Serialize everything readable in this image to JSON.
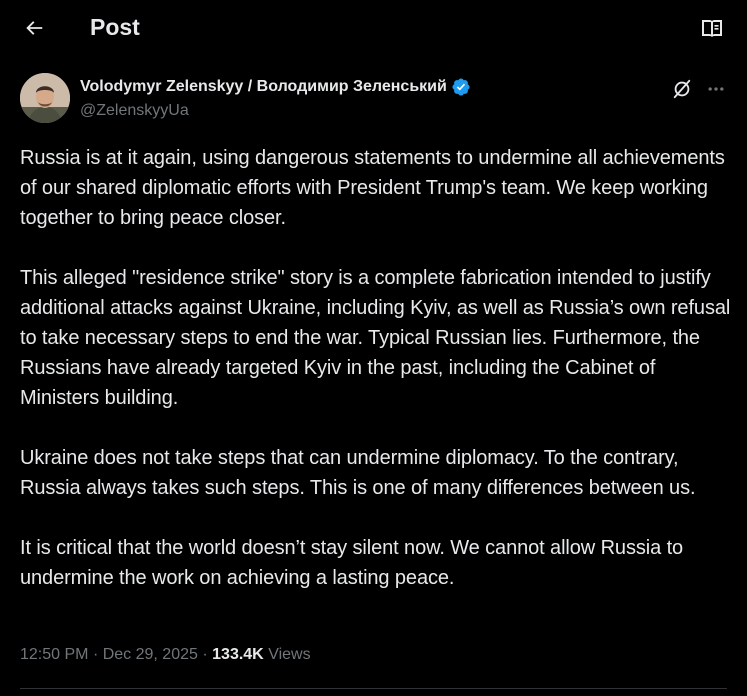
{
  "header": {
    "title": "Post",
    "back_icon": "arrow-left-icon",
    "reader_icon": "open-book-icon"
  },
  "author": {
    "name": "Volodymyr Zelenskyy / Володимир Зеленський",
    "handle": "@ZelenskyyUa",
    "verified_color": "#1d9bf0"
  },
  "post": {
    "paragraphs": [
      "Russia is at it again, using dangerous statements to undermine all achievements of our shared diplomatic efforts with President Trump's team. We keep working together to bring peace closer.",
      "This alleged \"residence strike\" story is a complete fabrication intended to justify additional attacks against Ukraine, including Kyiv, as well as Russia’s own refusal to take necessary steps to end the war. Typical Russian lies. Furthermore, the Russians have already targeted Kyiv in the past, including the Cabinet of Ministers building.",
      "Ukraine does not take steps that can undermine diplomacy. To the contrary, Russia always takes such steps. This is one of many differences between us.",
      "It is critical that the world doesn’t stay silent now. We cannot allow Russia to undermine the work on achieving a lasting peace."
    ],
    "time": "12:50 PM",
    "separator": "·",
    "date": "Dec 29, 2025",
    "views_count": "133.4K",
    "views_label": "Views"
  },
  "colors": {
    "background": "#000000",
    "text": "#e7e9ea",
    "secondary": "#71767b",
    "border": "#2f3336"
  }
}
